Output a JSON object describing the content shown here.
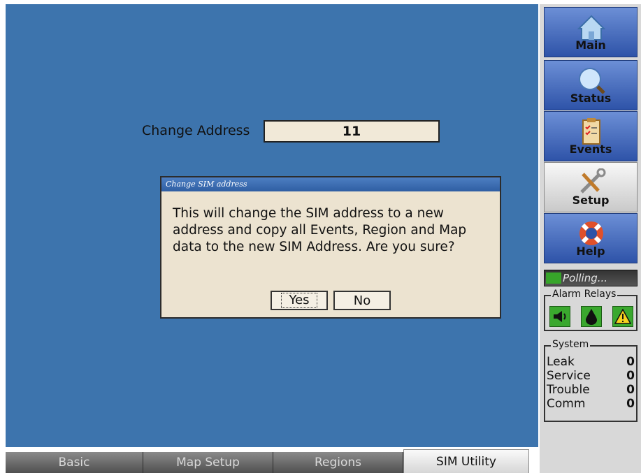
{
  "form": {
    "change_address_label": "Change Address",
    "change_address_value": "11"
  },
  "dialog": {
    "title": "Change SIM address",
    "message": "This will change the SIM address to a new address and copy all Events, Region and Map data to the new SIM Address. Are you sure?",
    "yes_label": "Yes",
    "no_label": "No"
  },
  "tabs": [
    {
      "label": "Basic",
      "active": false
    },
    {
      "label": "Map Setup",
      "active": false
    },
    {
      "label": "Regions",
      "active": false
    },
    {
      "label": "SIM Utility",
      "active": true
    }
  ],
  "nav": [
    {
      "label": "Main",
      "icon": "house-icon"
    },
    {
      "label": "Status",
      "icon": "magnifier-icon"
    },
    {
      "label": "Events",
      "icon": "clipboard-icon"
    },
    {
      "label": "Setup",
      "icon": "tools-icon",
      "active": true
    },
    {
      "label": "Help",
      "icon": "lifebuoy-icon"
    }
  ],
  "polling_text": "Polling...",
  "alarm_relays": {
    "title": "Alarm Relays",
    "icons": [
      "horn-icon",
      "drop-icon",
      "warning-icon"
    ]
  },
  "system": {
    "title": "System",
    "rows": [
      {
        "label": "Leak",
        "value": "0"
      },
      {
        "label": "Service",
        "value": "0"
      },
      {
        "label": "Trouble",
        "value": "0"
      },
      {
        "label": "Comm",
        "value": "0"
      }
    ]
  },
  "colors": {
    "workarea": "#3d74ad",
    "dialog_bg": "#ece3d0",
    "relay_green": "#3aa82e"
  }
}
